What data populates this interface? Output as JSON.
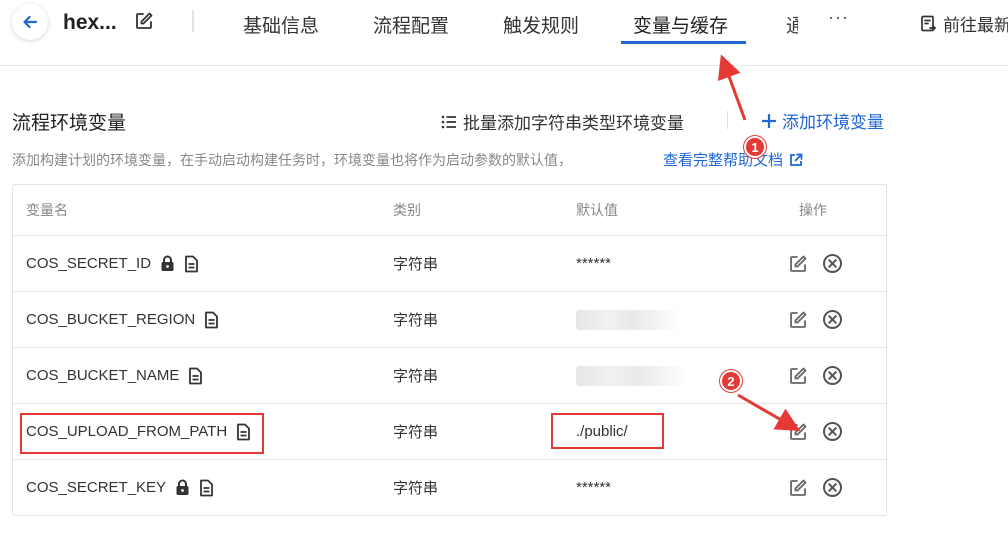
{
  "header": {
    "project_name": "hex...",
    "tabs": [
      {
        "label": "基础信息"
      },
      {
        "label": "流程配置"
      },
      {
        "label": "触发规则"
      },
      {
        "label": "变量与缓存"
      },
      {
        "label": "通"
      }
    ],
    "more_label": "···",
    "goto_label": "前往最新"
  },
  "section": {
    "title": "流程环境变量",
    "batch_add_label": "批量添加字符串类型环境变量",
    "add_label": "添加环境变量",
    "description": "添加构建计划的环境变量，在手动启动构建任务时，环境变量也将作为启动参数的默认值，",
    "doc_link": "查看完整帮助文档"
  },
  "table": {
    "headers": {
      "name": "变量名",
      "type": "类别",
      "default": "默认值",
      "ops": "操作"
    },
    "rows": [
      {
        "name": "COS_SECRET_ID",
        "locked": true,
        "type": "字符串",
        "value": "******",
        "blurred": false
      },
      {
        "name": "COS_BUCKET_REGION",
        "locked": false,
        "type": "字符串",
        "value": "",
        "blurred": true
      },
      {
        "name": "COS_BUCKET_NAME",
        "locked": false,
        "type": "字符串",
        "value": "",
        "blurred": true
      },
      {
        "name": "COS_UPLOAD_FROM_PATH",
        "locked": false,
        "type": "字符串",
        "value": "./public/",
        "blurred": false
      },
      {
        "name": "COS_SECRET_KEY",
        "locked": true,
        "type": "字符串",
        "value": "******",
        "blurred": false
      }
    ]
  },
  "annotations": {
    "badge_1": "1",
    "badge_2": "2",
    "color": "#e53935"
  },
  "colors": {
    "accent": "#2066d6",
    "annotation": "#e53935"
  },
  "icons": {
    "back": "arrow-left-icon",
    "edit": "edit-icon",
    "list": "list-icon",
    "plus": "plus-icon",
    "external": "external-link-icon",
    "lock": "lock-icon",
    "doc": "document-icon",
    "delete": "close-circle-icon",
    "goto": "document-arrow-icon"
  }
}
